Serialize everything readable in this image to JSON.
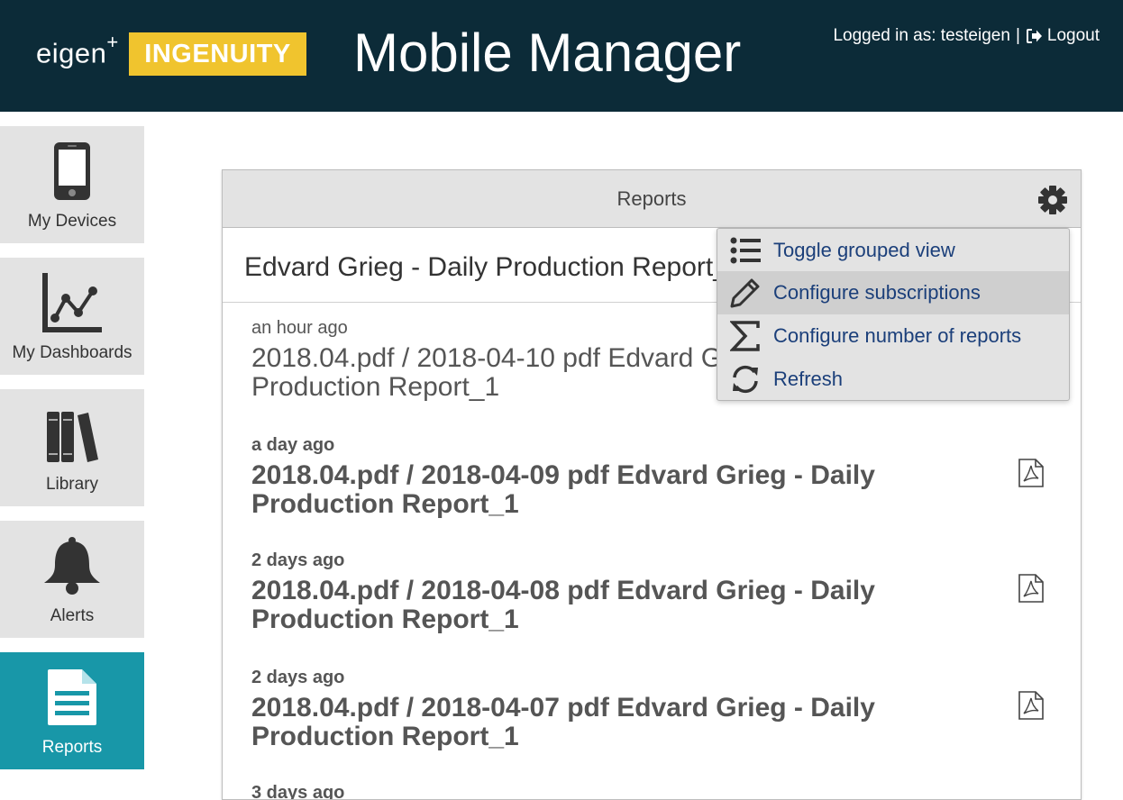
{
  "header": {
    "logo_prefix": "eigen",
    "logo_plus": "+",
    "logo_product": "INGENUITY",
    "app_title": "Mobile Manager",
    "logged_in_label": "Logged in as: testeigen",
    "separator": "|",
    "logout_label": "Logout"
  },
  "sidebar": {
    "items": [
      {
        "label": "My Devices",
        "icon": "phone-icon"
      },
      {
        "label": "My Dashboards",
        "icon": "line-chart-icon"
      },
      {
        "label": "Library",
        "icon": "books-icon"
      },
      {
        "label": "Alerts",
        "icon": "bell-icon"
      },
      {
        "label": "Reports",
        "icon": "document-icon",
        "active": true
      }
    ]
  },
  "panel": {
    "title": "Reports",
    "group_title": "Edvard Grieg - Daily Production Report_1",
    "reports": [
      {
        "when": "an hour ago",
        "title": "2018.04.pdf / 2018-04-10 pdf Edvard Grieg - Daily Production Report_1",
        "unread": false
      },
      {
        "when": "a day ago",
        "title": "2018.04.pdf / 2018-04-09 pdf Edvard Grieg - Daily Production Report_1",
        "unread": true
      },
      {
        "when": "2 days ago",
        "title": "2018.04.pdf / 2018-04-08 pdf Edvard Grieg - Daily Production Report_1",
        "unread": true
      },
      {
        "when": "2 days ago",
        "title": "2018.04.pdf / 2018-04-07 pdf Edvard Grieg - Daily Production Report_1",
        "unread": true
      },
      {
        "when": "3 days ago",
        "title": "",
        "unread": true
      }
    ]
  },
  "menu": {
    "items": [
      {
        "label": "Toggle grouped view",
        "icon": "list-icon"
      },
      {
        "label": "Configure subscriptions",
        "icon": "pencil-icon",
        "highlighted": true
      },
      {
        "label": "Configure number of reports",
        "icon": "sigma-icon"
      },
      {
        "label": "Refresh",
        "icon": "refresh-icon"
      }
    ]
  },
  "colors": {
    "header_bg": "#0c2b38",
    "logo_yellow": "#f0c42e",
    "active_nav": "#1897a8",
    "menu_text": "#1b3f7a"
  }
}
